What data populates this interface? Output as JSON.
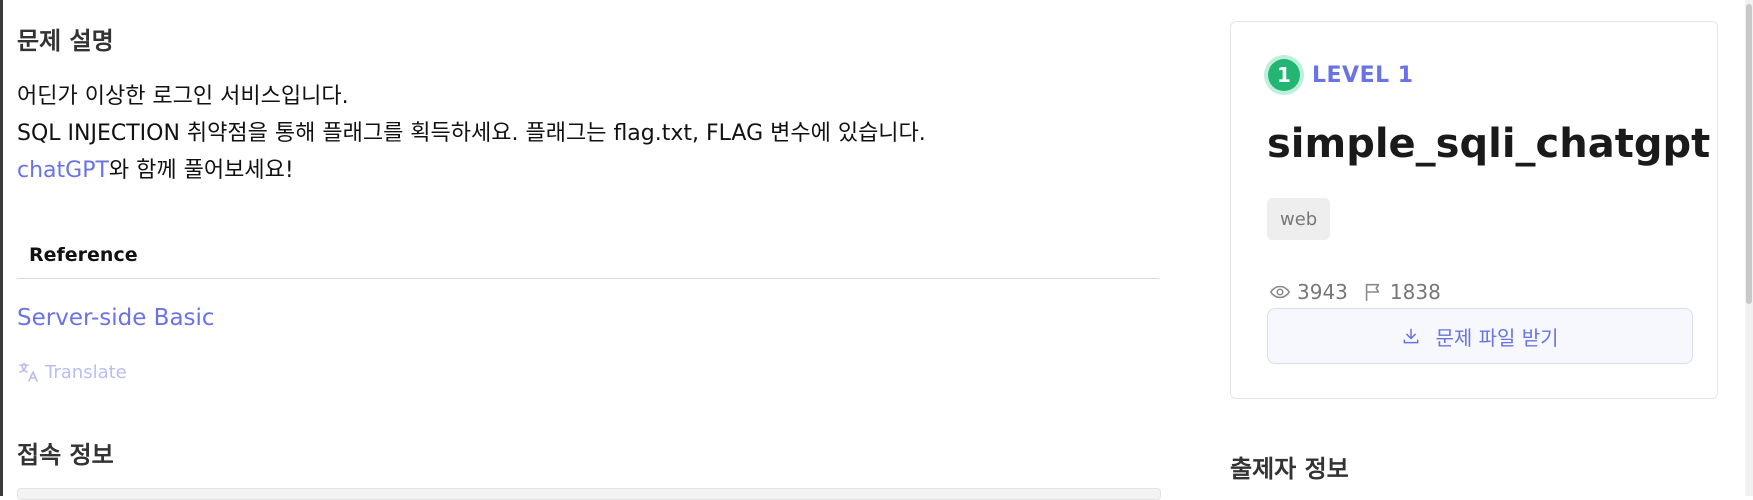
{
  "description": {
    "title": "문제 설명",
    "line1": "어딘가 이상한 로그인 서비스입니다.",
    "line2": "SQL INJECTION 취약점을 통해 플래그를 획득하세요. 플래그는 flag.txt, FLAG 변수에 있습니다.",
    "line3_link": "chatGPT",
    "line3_rest": "와 함께 풀어보세요!"
  },
  "reference": {
    "header": "Reference",
    "link": "Server-side Basic"
  },
  "translate_label": "Translate",
  "connection": {
    "title": "접속 정보"
  },
  "challenge": {
    "level_number": "1",
    "level_label": "LEVEL 1",
    "title": "simple_sqli_chatgpt",
    "tag": "web",
    "views": "3943",
    "solves": "1838",
    "download_label": "문제 파일 받기"
  },
  "author": {
    "title": "출제자 정보"
  },
  "colors": {
    "accent": "#6a73e6",
    "level_green": "#22b573"
  },
  "icons": {
    "views": "eye-icon",
    "solves": "flag-icon",
    "download": "download-icon",
    "translate": "translate-icon"
  }
}
